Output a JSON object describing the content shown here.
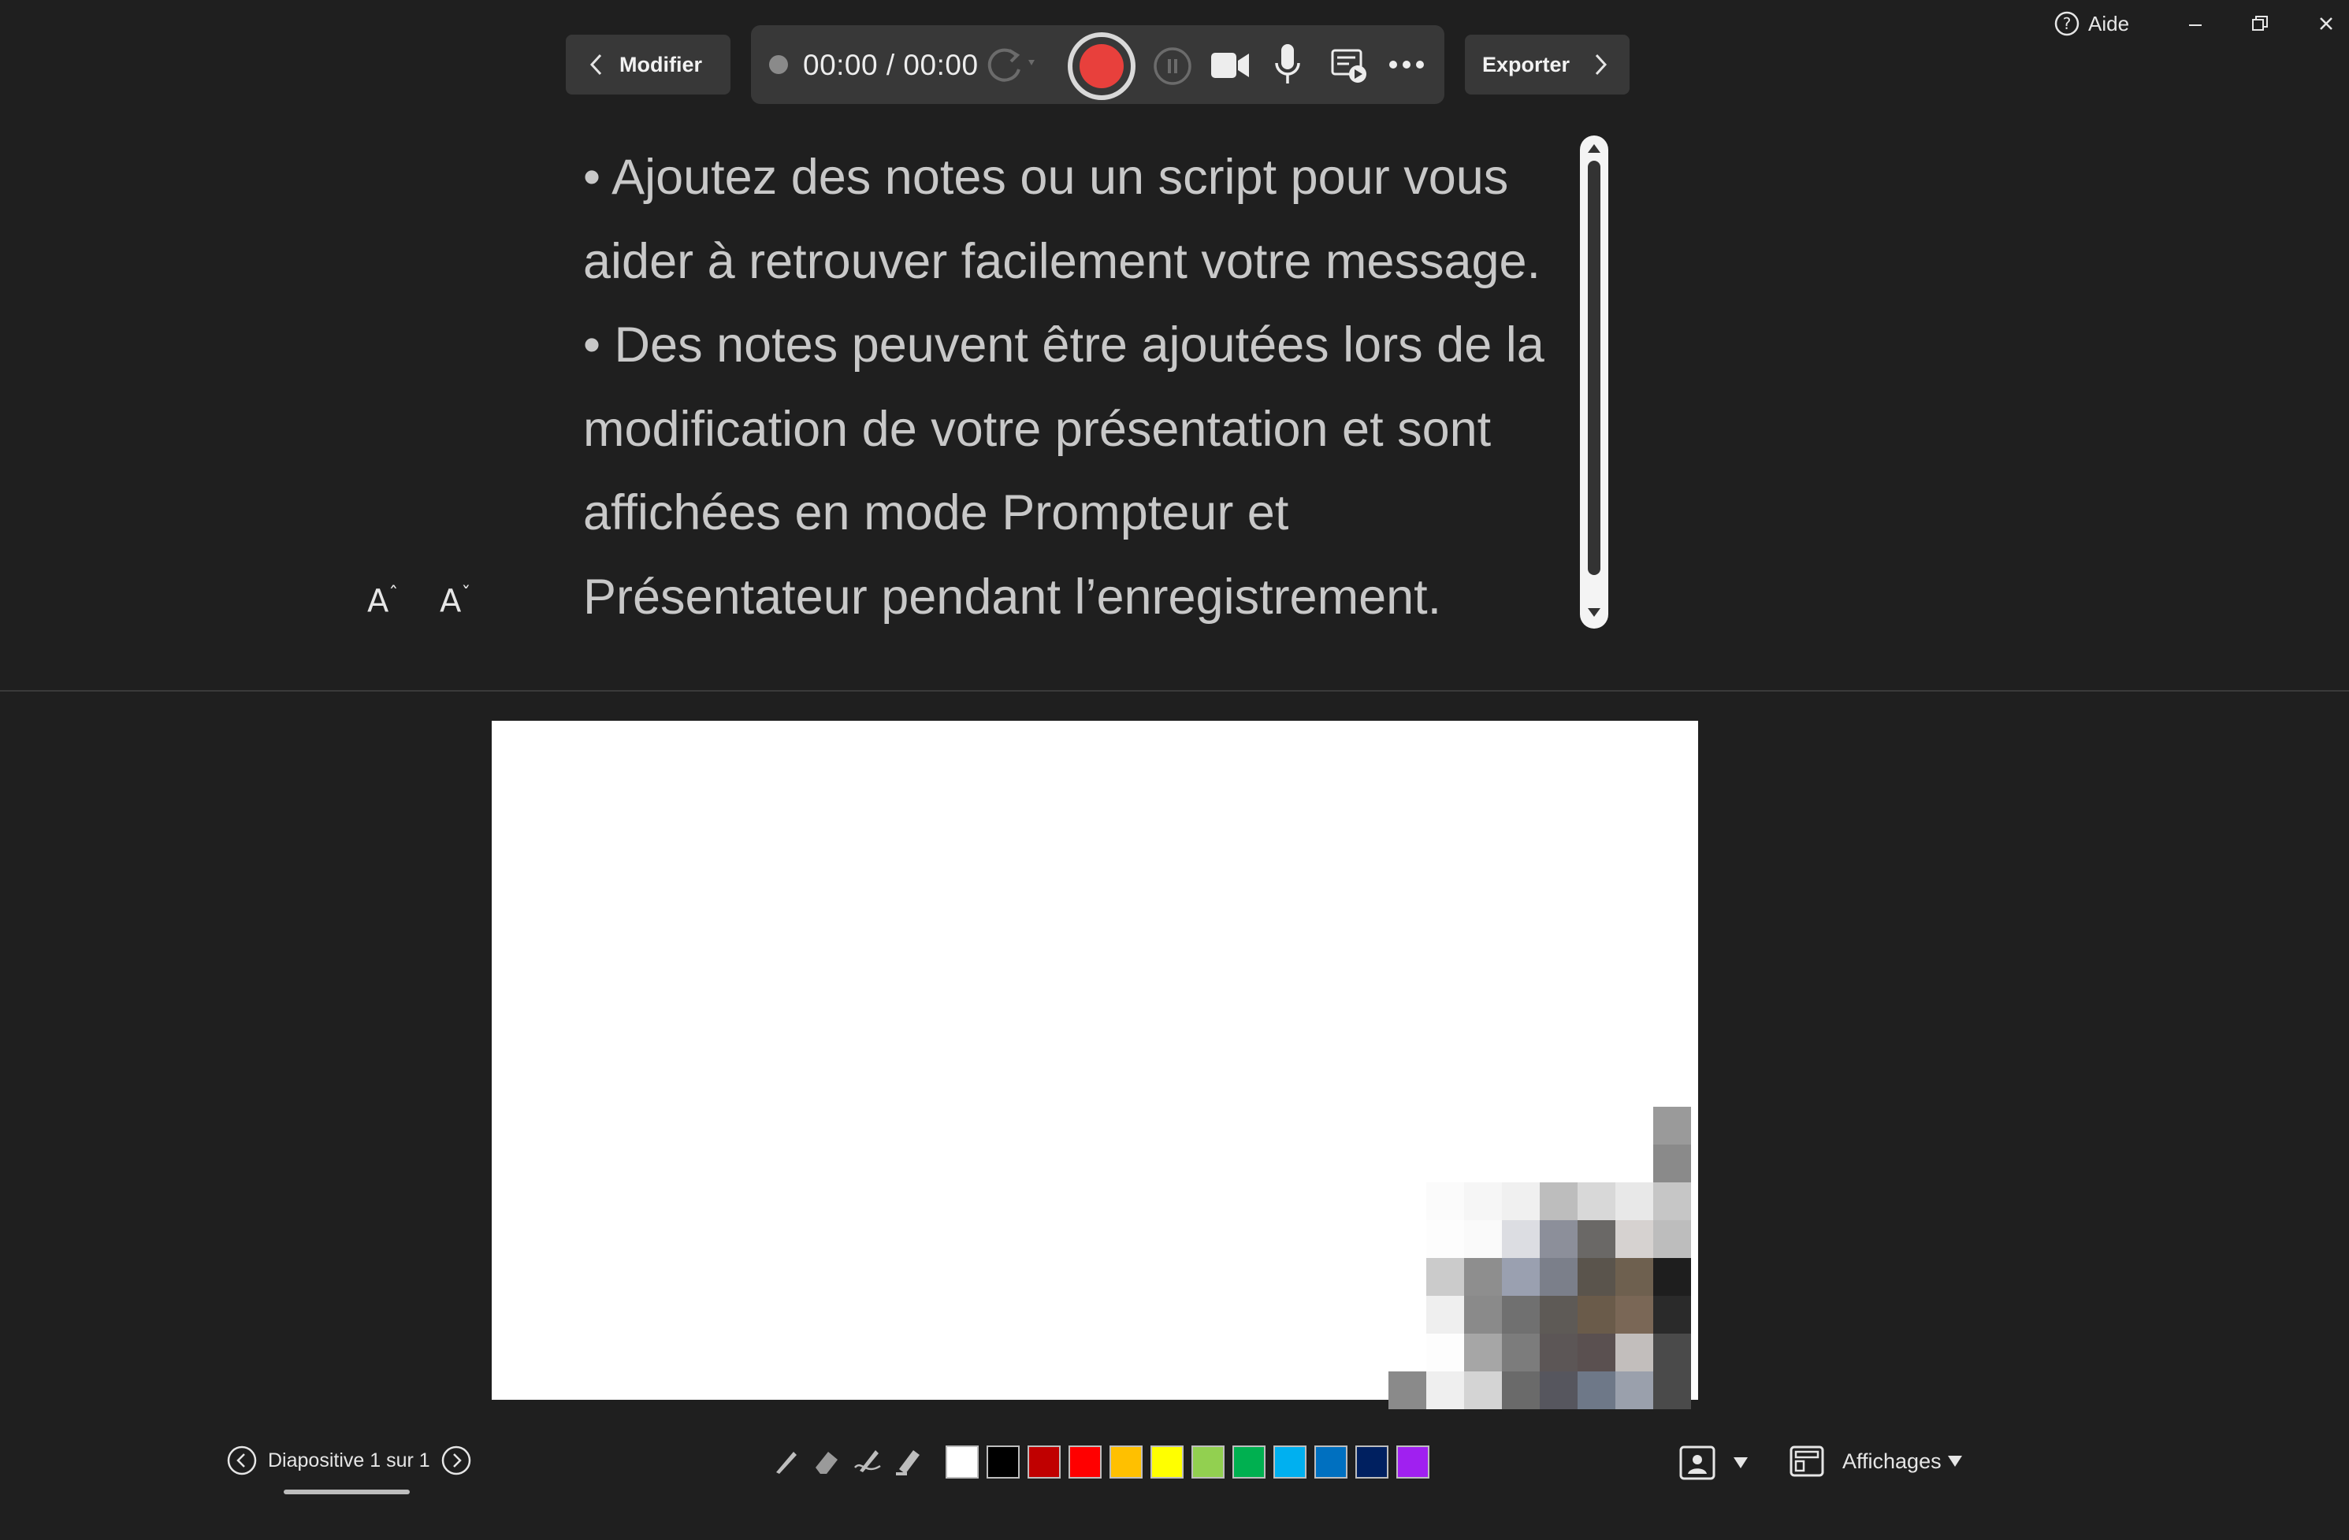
{
  "window": {
    "help_label": "Aide",
    "help_icon": "question-circle-icon",
    "minimize_icon": "minimize-icon",
    "restore_icon": "restore-icon",
    "close_icon": "close-icon"
  },
  "toolbar": {
    "back_label": "Modifier",
    "export_label": "Exporter",
    "timer": "00:00 / 00:00",
    "record_color": "#e8403c",
    "icons": [
      "status-dot-icon",
      "retake-icon",
      "record-icon",
      "pause-icon",
      "camera-icon",
      "microphone-icon",
      "teleprompter-icon",
      "more-icon"
    ]
  },
  "notes": {
    "lines": [
      "• Ajoutez des notes ou un script pour vous",
      "aider à retrouver facilement votre message.",
      "• Des notes peuvent être ajoutées lors de la",
      "modification de votre présentation et sont",
      "affichées en mode Prompteur et",
      "Présentateur pendant l’enregistrement."
    ],
    "font_increase_label": "A",
    "font_decrease_label": "A",
    "font_increase_mark": "ˆ",
    "font_decrease_mark": "ˇ"
  },
  "footer": {
    "slide_label": "Diapositive 1 sur 1",
    "views_label": "Affichages",
    "tools": [
      "pen-icon",
      "eraser-icon",
      "pen-style-icon",
      "highlighter-icon"
    ],
    "colors": [
      "#ffffff",
      "#000000",
      "#c00000",
      "#ff0000",
      "#ffc000",
      "#ffff00",
      "#92d050",
      "#00b050",
      "#00b0f0",
      "#0070c0",
      "#002060",
      "#a020f0"
    ]
  }
}
